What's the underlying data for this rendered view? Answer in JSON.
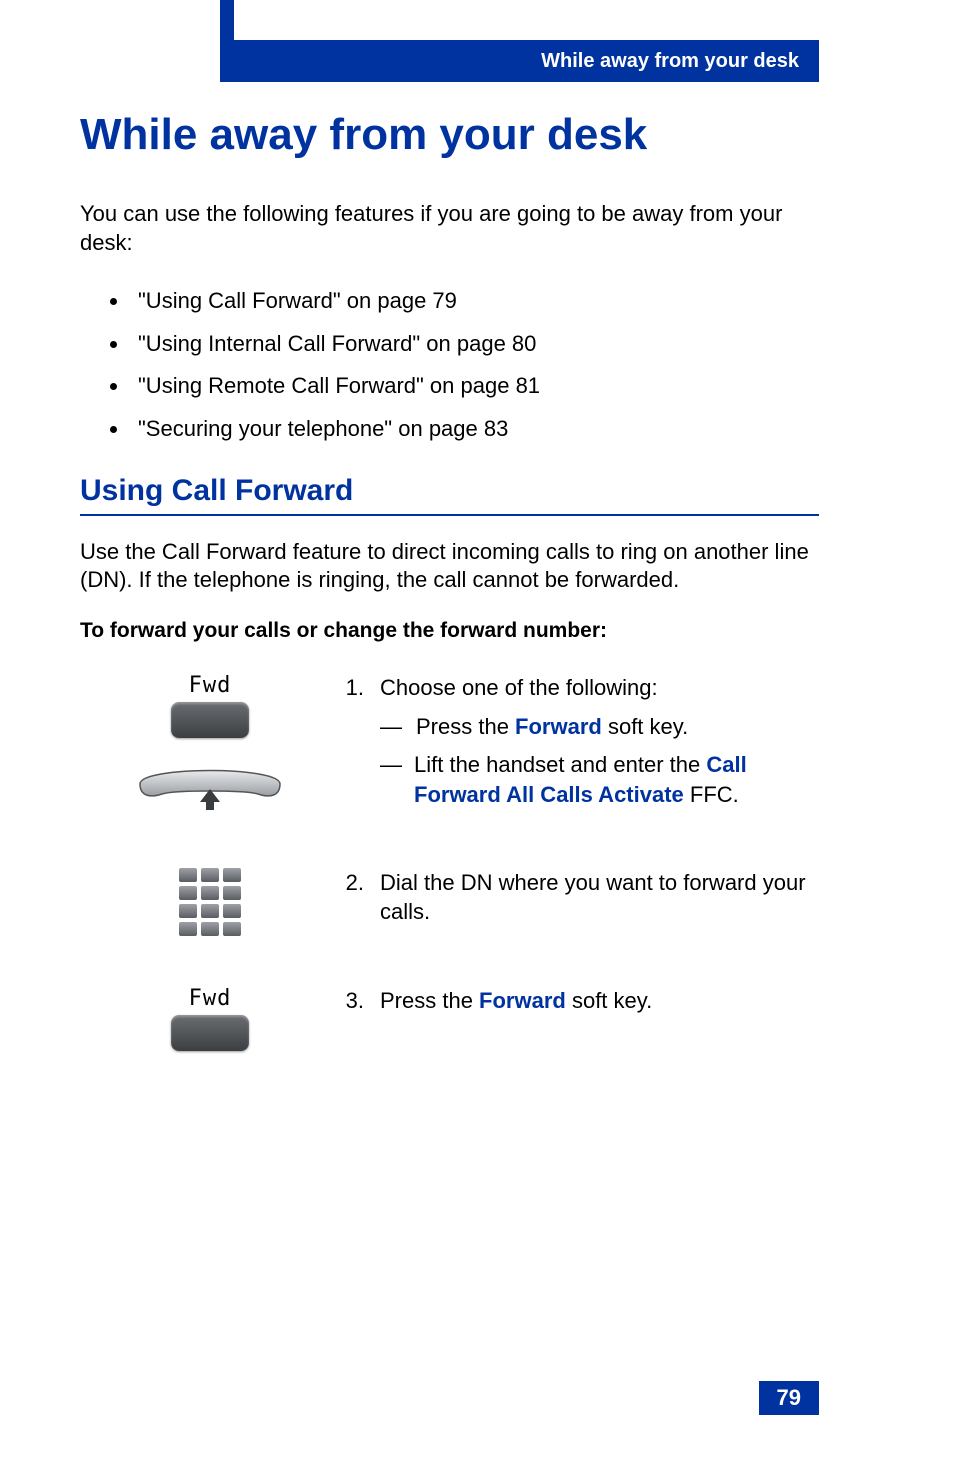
{
  "header": {
    "title": "While away from your desk"
  },
  "page": {
    "title": "While away from your desk",
    "intro": "You can use the following features if you are going to be away from your desk:",
    "features": [
      "\"Using Call Forward\" on page 79",
      "\"Using Internal Call Forward\" on page 80",
      "\"Using Remote Call Forward\" on page 81",
      "\"Securing your telephone\" on page 83"
    ],
    "section_title": "Using Call Forward",
    "section_desc": "Use the Call Forward feature to direct incoming calls to ring on another line (DN). If the telephone is ringing, the call cannot be forwarded.",
    "procedure_title": "To forward your calls or change the forward number:",
    "number": "79"
  },
  "icons": {
    "fwd_label": "Fwd"
  },
  "steps": {
    "s1": {
      "num": "1.",
      "text": "Choose one of the following:",
      "sub1_pre": "Press the ",
      "sub1_key": "Forward",
      "sub1_post": " soft key.",
      "sub2_pre": "Lift the handset and enter the ",
      "sub2_key": "Call Forward All Calls Activate",
      "sub2_post": " FFC."
    },
    "s2": {
      "num": "2.",
      "text": "Dial the DN where you want to forward your calls."
    },
    "s3": {
      "num": "3.",
      "pre": "Press the ",
      "key": "Forward",
      "post": " soft key."
    }
  }
}
